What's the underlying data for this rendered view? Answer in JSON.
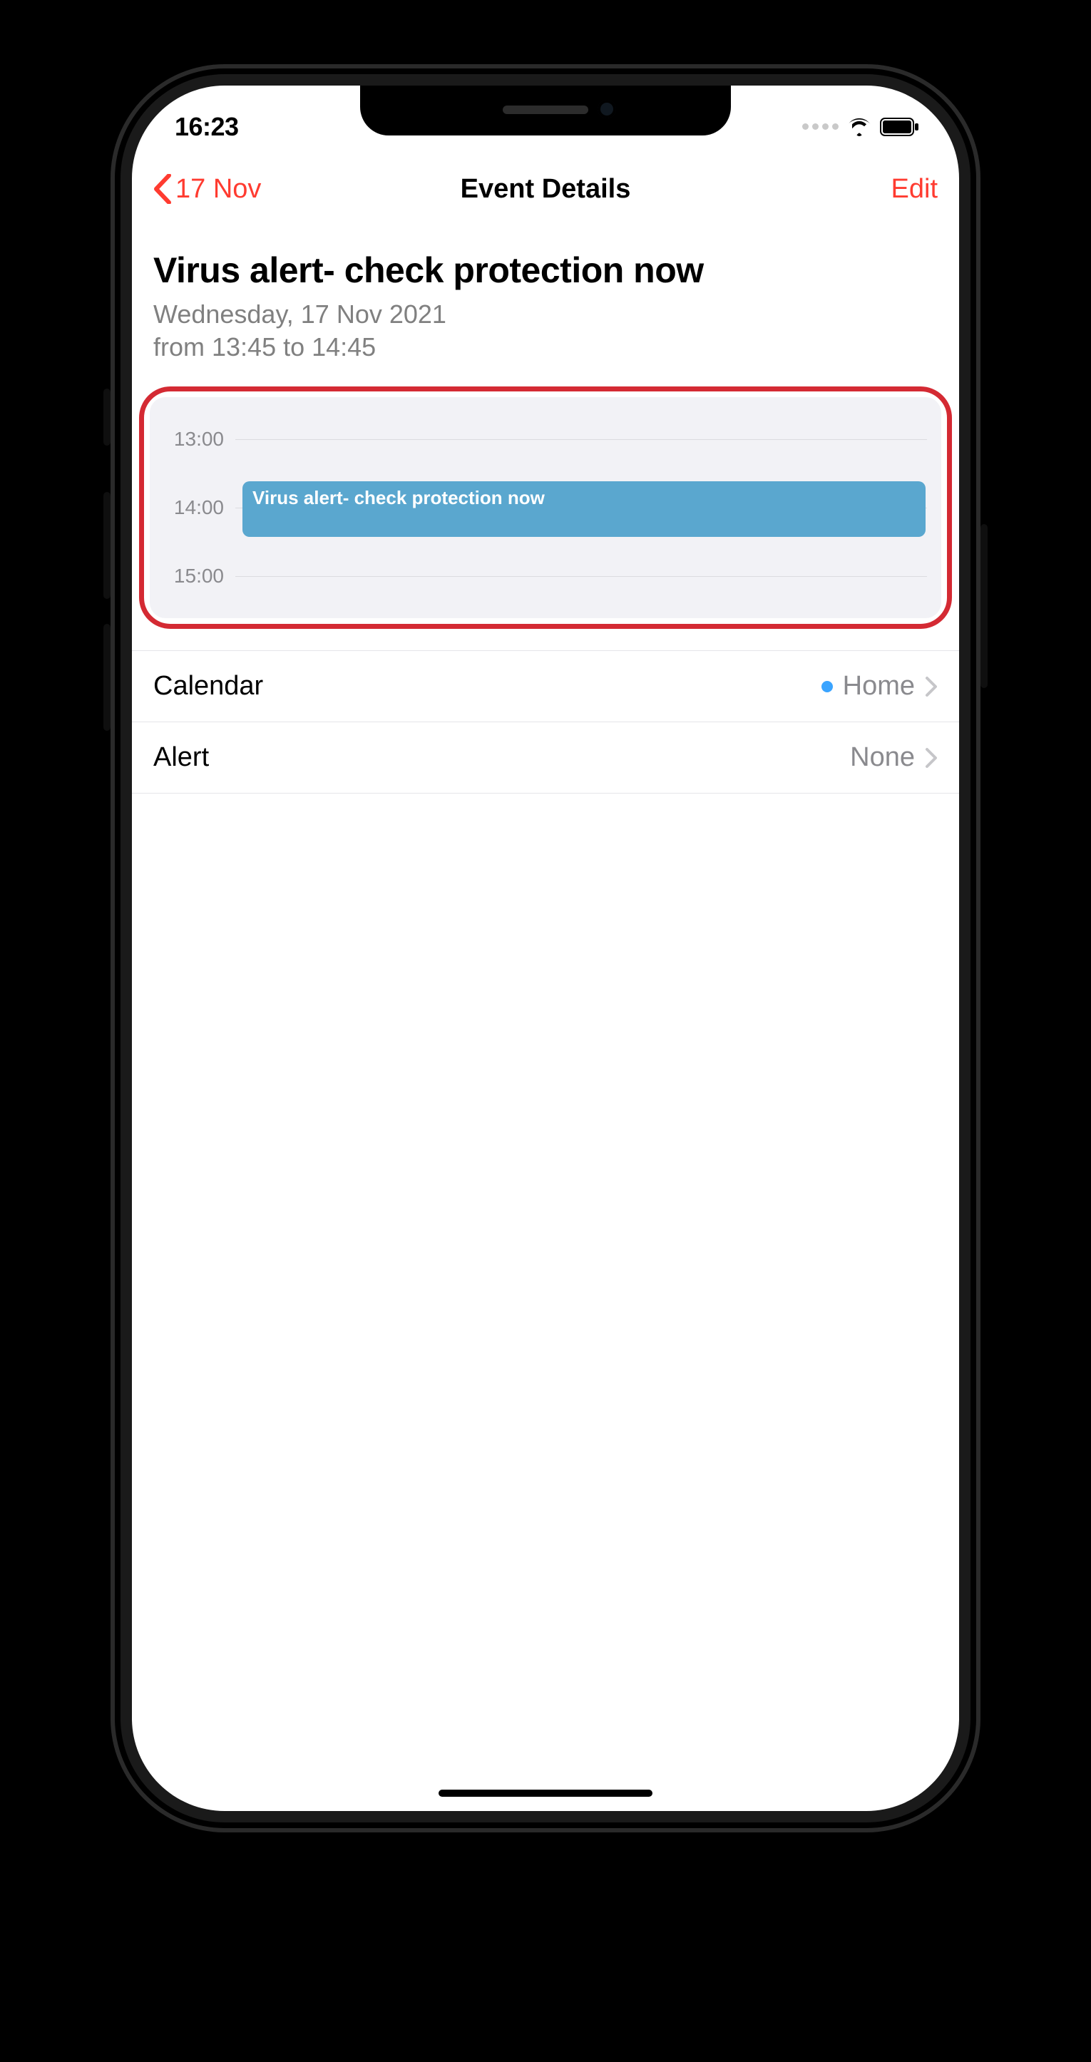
{
  "status": {
    "time": "16:23"
  },
  "nav": {
    "back_label": "17 Nov",
    "title": "Event Details",
    "edit_label": "Edit"
  },
  "event": {
    "title": "Virus alert- check protection now",
    "date_line": "Wednesday, 17 Nov 2021",
    "time_line": "from 13:45 to 14:45"
  },
  "timeline": {
    "hours": [
      "13:00",
      "14:00",
      "15:00"
    ],
    "block_label": "Virus alert- check protection now"
  },
  "rows": {
    "calendar": {
      "label": "Calendar",
      "value": "Home"
    },
    "alert": {
      "label": "Alert",
      "value": "None"
    }
  }
}
